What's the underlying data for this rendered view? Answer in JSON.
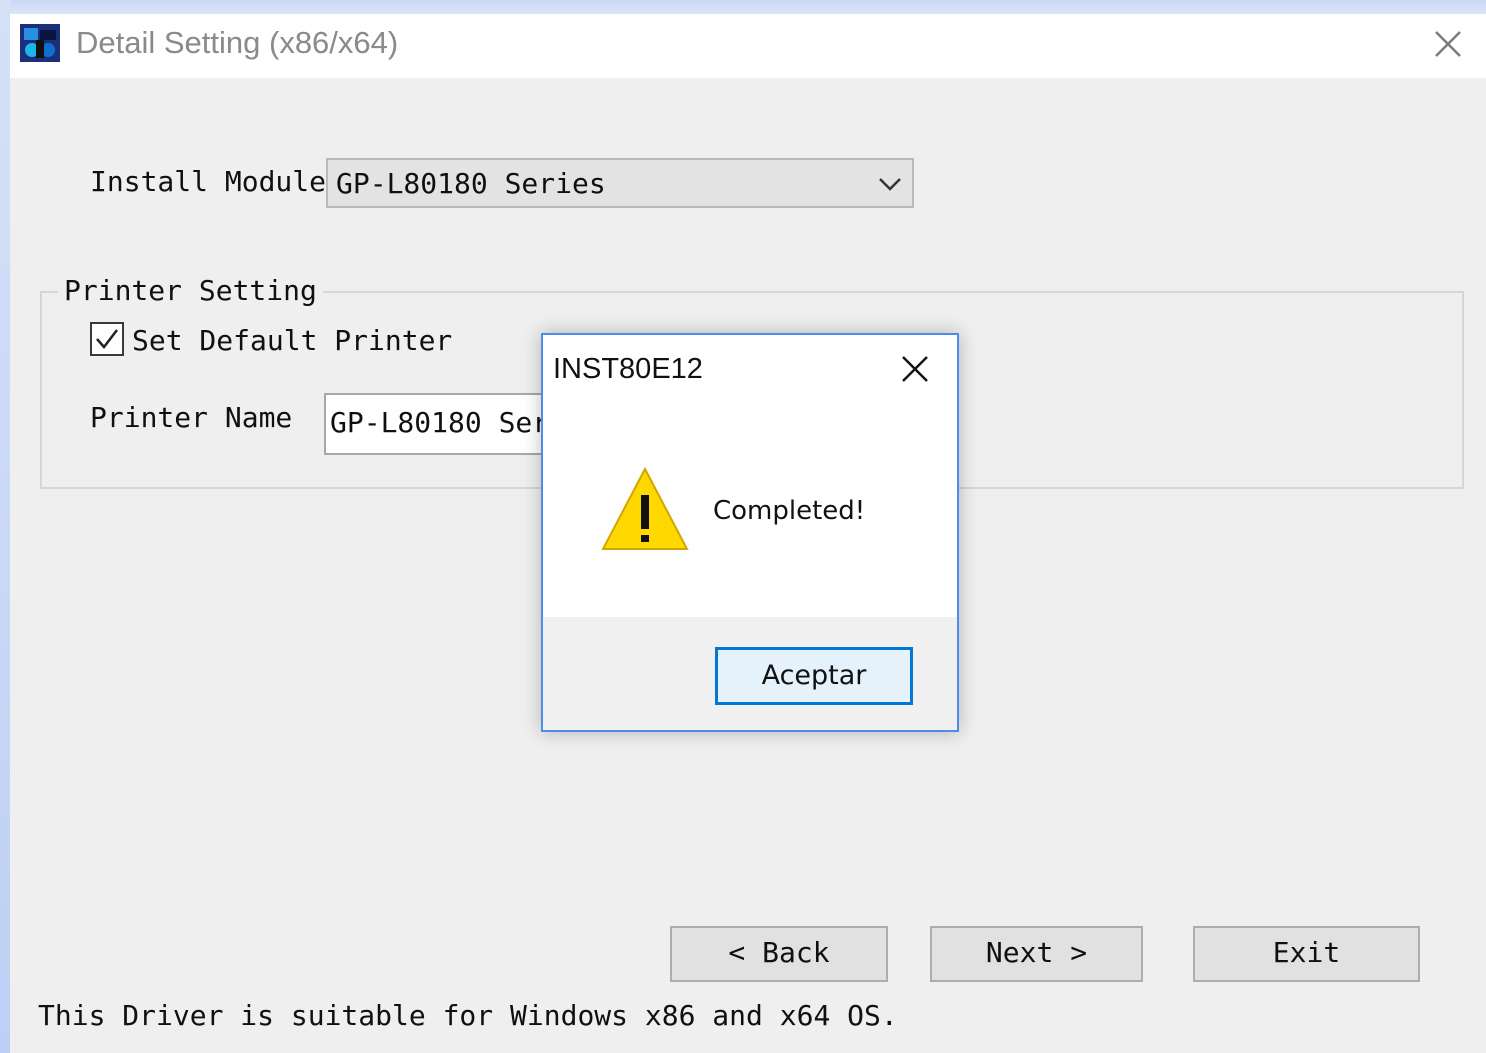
{
  "window": {
    "title": "Detail Setting (x86/x64)"
  },
  "install_module": {
    "label": "Install Module",
    "selected": "GP-L80180 Series"
  },
  "printer_setting": {
    "group_label": "Printer Setting",
    "set_default_label": "Set Default Printer",
    "set_default_checked": true,
    "printer_name_label": "Printer Name",
    "printer_name_value": "GP-L80180 Series"
  },
  "buttons": {
    "back": "< Back",
    "next": "Next >",
    "exit": "Exit"
  },
  "footer_note": "This Driver is suitable for Windows x86 and x64 OS.",
  "dialog": {
    "title": "INST80E12",
    "message": "Completed!",
    "icon": "warning-icon",
    "ok_label": "Aceptar",
    "accent_color": "#0078d7"
  }
}
